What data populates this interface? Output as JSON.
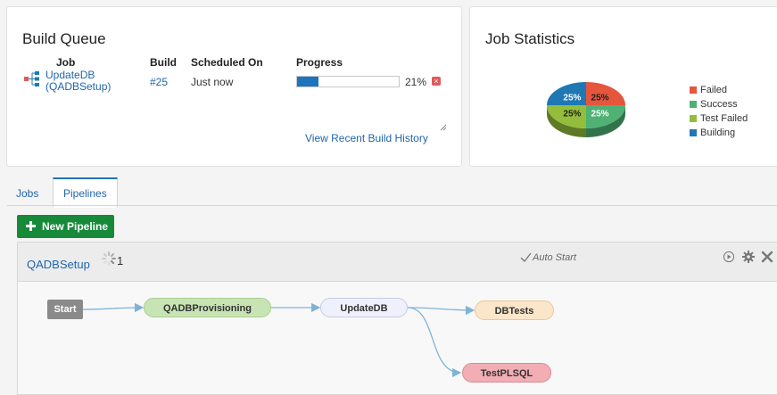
{
  "build_queue": {
    "title": "Build Queue",
    "headers": {
      "job": "Job",
      "build": "Build",
      "scheduled": "Scheduled On",
      "progress": "Progress"
    },
    "row": {
      "job_line1": "UpdateDB",
      "job_line2": "(QADBSetup)",
      "build": "#25",
      "scheduled": "Just now",
      "progress_percent": 21,
      "progress_label": "21%"
    },
    "history_link": "View Recent Build History"
  },
  "job_statistics": {
    "title": "Job Statistics",
    "chart_data": {
      "type": "pie",
      "categories": [
        "Failed",
        "Success",
        "Test Failed",
        "Building"
      ],
      "values": [
        25,
        25,
        25,
        25
      ],
      "slice_labels": [
        "25%",
        "25%",
        "25%",
        "25%"
      ],
      "colors": [
        "#e5563c",
        "#4fb174",
        "#93bd3b",
        "#1f78b4"
      ],
      "legend_position": "right"
    }
  },
  "tabs": [
    {
      "label": "Jobs",
      "active": false
    },
    {
      "label": "Pipelines",
      "active": true
    }
  ],
  "new_pipeline_label": "New Pipeline",
  "pipeline": {
    "name": "QADBSetup",
    "run_count": "1",
    "auto_start": "Auto Start",
    "nodes": {
      "start": "Start",
      "provisioning": "QADBProvisioning",
      "update": "UpdateDB",
      "dbtests": "DBTests",
      "testplsql": "TestPLSQL"
    }
  },
  "colors": {
    "accent": "#1e73be",
    "new_pipeline_green": "#178a3a",
    "node_start": "#8a8a8a",
    "node_provisioning": "#c9e4b4",
    "node_update": "#eef0fb",
    "node_dbtests": "#fbe6c9",
    "node_testplsql": "#f2aeb4"
  },
  "icons": [
    "job-tree-icon",
    "cancel-icon",
    "spinner-icon",
    "checkmark-icon",
    "play-icon",
    "gear-icon",
    "close-icon",
    "plus-icon",
    "resize-grip-icon"
  ]
}
